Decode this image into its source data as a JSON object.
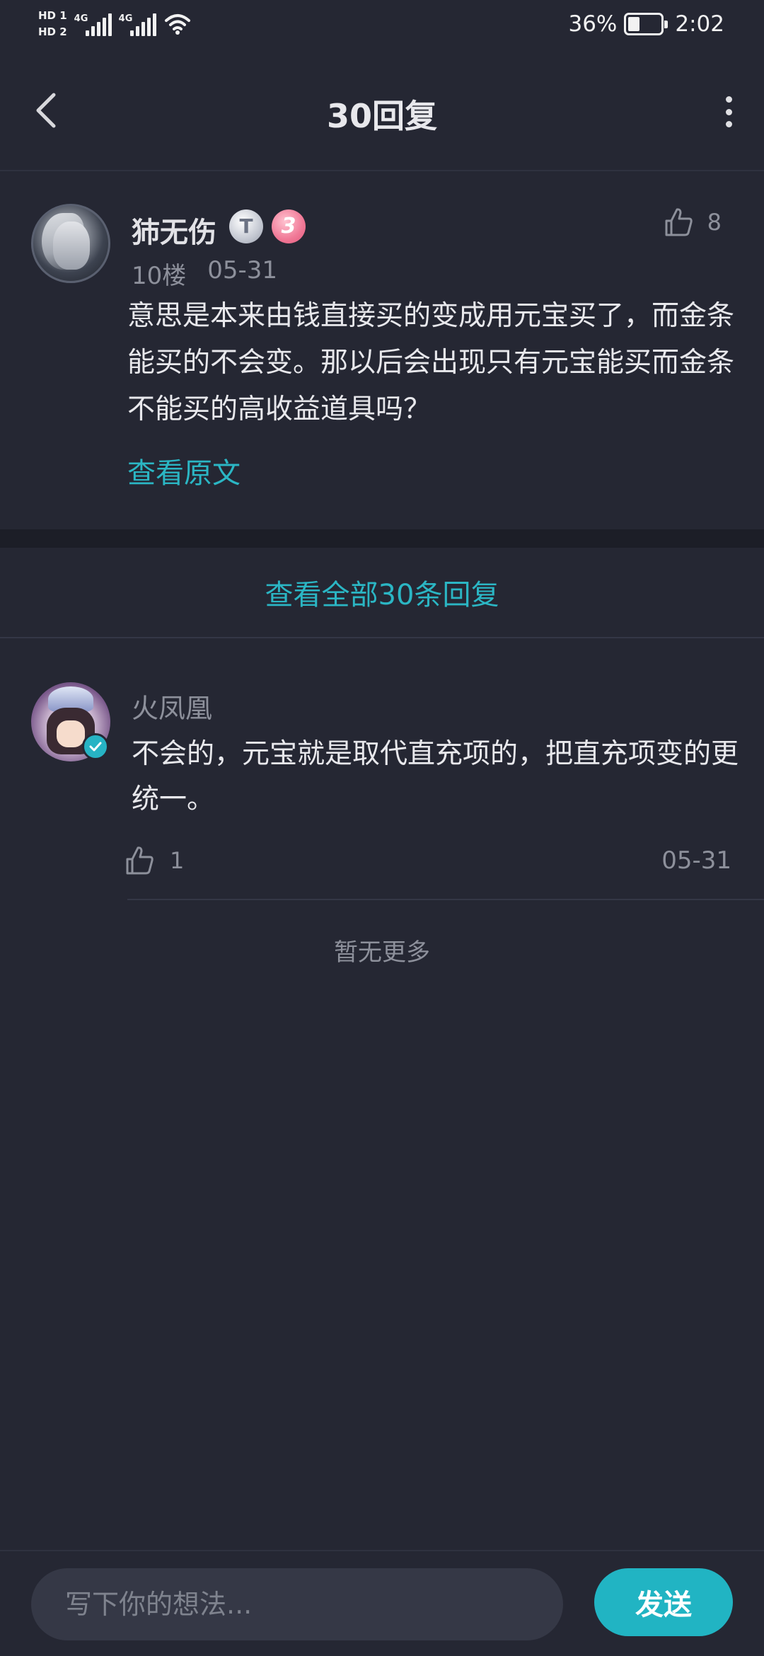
{
  "status_bar": {
    "hd1": "HD 1",
    "hd2": "HD 2",
    "net1": "4G",
    "net2": "4G",
    "battery_text": "36%",
    "battery_level": 0.36,
    "time": "2:02"
  },
  "header": {
    "title": "30回复"
  },
  "main_comment": {
    "user_name": "犻无伤",
    "badge_title": "T",
    "level_badge": "3",
    "floor": "10楼",
    "date": "05-31",
    "like_count": "8",
    "content": "意思是本来由钱直接买的变成用元宝买了，而金条能买的不会变。那以后会出现只有元宝能买而金条不能买的高收益道具吗？",
    "view_original": "查看原文"
  },
  "view_all_replies": "查看全部30条回复",
  "reply": {
    "user_name": "火凤凰",
    "content": "不会的，元宝就是取代直充项的，把直充项变的更统一。",
    "like_count": "1",
    "date": "05-31"
  },
  "no_more": "暂无更多",
  "bottom_bar": {
    "input_placeholder": "写下你的想法...",
    "send_label": "发送"
  },
  "colors": {
    "background": "#252733",
    "accent": "#21b4c3"
  }
}
